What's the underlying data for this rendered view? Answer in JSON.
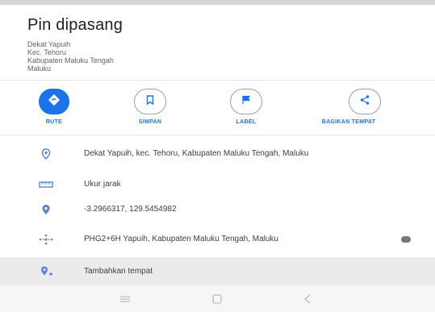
{
  "header": {
    "title": "Pin dipasang",
    "address_lines": [
      "Dekat Yapuih",
      "Kec. Tehoru",
      "Kabupaten Maluku Tengah",
      "Maluku"
    ]
  },
  "actions": [
    {
      "label": "RUTE",
      "icon": "directions-icon"
    },
    {
      "label": "SIMPAN",
      "icon": "bookmark-icon"
    },
    {
      "label": "LABEL",
      "icon": "flag-icon"
    },
    {
      "label": "BAGIKAN TEMPAT",
      "icon": "share-icon"
    }
  ],
  "details": [
    {
      "icon": "location-pin-icon",
      "text": "Dekat Yapuih, kec. Tehoru, Kabupaten Maluku Tengah, Maluku"
    },
    {
      "icon": "ruler-icon",
      "text": "Ukur jarak"
    },
    {
      "icon": "coordinates-pin-icon",
      "text": "-3.2966317, 129.5454982"
    },
    {
      "icon": "plus-code-icon",
      "text": "PHG2+6H Yapuih, Kabupaten Maluku Tengah, Maluku"
    },
    {
      "icon": "add-place-icon",
      "text": "Tambahkan tempat"
    }
  ],
  "colors": {
    "accent": "#1a73e8",
    "icon_blue": "#5b86c9",
    "band": "#ebebeb"
  }
}
